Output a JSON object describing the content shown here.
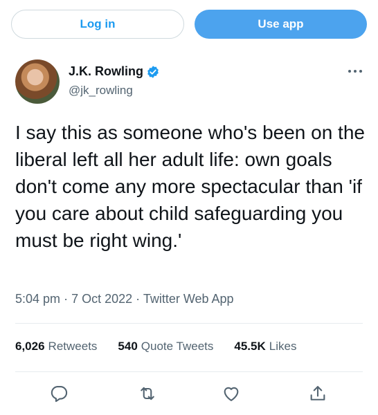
{
  "header": {
    "login_label": "Log in",
    "use_app_label": "Use app"
  },
  "tweet": {
    "author_name": "J.K. Rowling",
    "author_handle": "@jk_rowling",
    "text": "I say this as someone who's been on the liberal left all her adult life: own goals don't come any more spectacular than 'if you care about child safeguarding you must be right wing.'",
    "time": "5:04 pm",
    "date": "7 Oct 2022",
    "source": "Twitter Web App",
    "sep": "·"
  },
  "stats": {
    "retweets_count": "6,026",
    "retweets_label": "Retweets",
    "quotes_count": "540",
    "quotes_label": "Quote Tweets",
    "likes_count": "45.5K",
    "likes_label": "Likes"
  },
  "colors": {
    "accent": "#1d9bf0",
    "secondary_text": "#536471",
    "primary_text": "#0f1419"
  },
  "icons": [
    "verified-badge-icon",
    "more-icon",
    "reply-icon",
    "retweet-icon",
    "like-icon",
    "share-icon"
  ]
}
